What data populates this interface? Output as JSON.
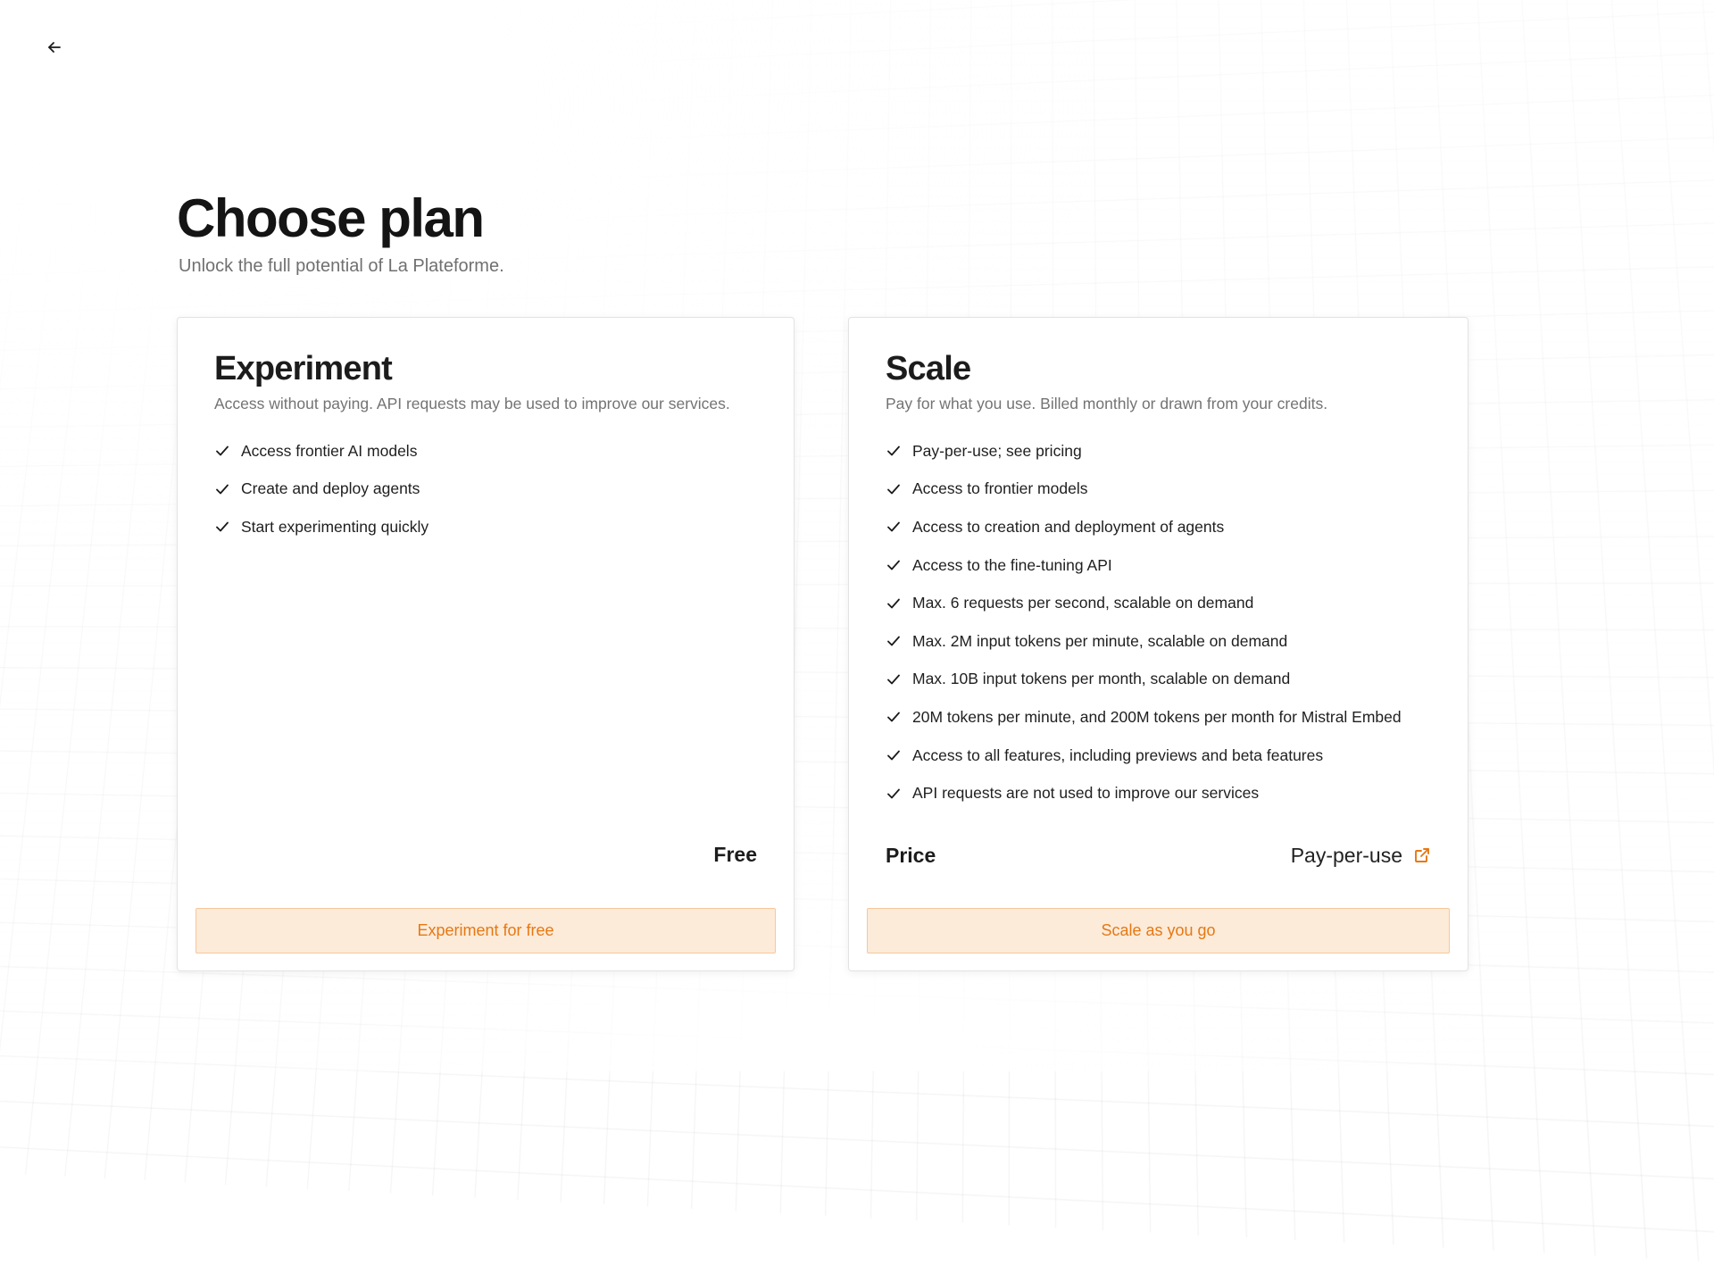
{
  "header": {
    "title": "Choose plan",
    "subtitle": "Unlock the full potential of La Plateforme."
  },
  "icons": {
    "back": "arrow-left-icon",
    "check": "check-icon",
    "external": "external-link-icon"
  },
  "colors": {
    "accent": "#e67813",
    "cta_background": "#fdebd9",
    "cta_border": "#f6c79a"
  },
  "plans": {
    "experiment": {
      "title": "Experiment",
      "description": "Access without paying. API requests may be used to improve our services.",
      "features": [
        "Access frontier AI models",
        "Create and deploy agents",
        "Start experimenting quickly"
      ],
      "price_value": "Free",
      "cta_label": "Experiment for free"
    },
    "scale": {
      "title": "Scale",
      "description": "Pay for what you use. Billed monthly or drawn from your credits.",
      "features": [
        "Pay-per-use; see pricing",
        "Access to frontier models",
        "Access to creation and deployment of agents",
        "Access to the fine-tuning API",
        "Max. 6 requests per second, scalable on demand",
        "Max. 2M input tokens per minute, scalable on demand",
        "Max. 10B input tokens per month, scalable on demand",
        "20M tokens per minute, and 200M tokens per month for Mistral Embed",
        "Access to all features, including previews and beta features",
        "API requests are not used to improve our services"
      ],
      "price_label": "Price",
      "price_value": "Pay-per-use",
      "cta_label": "Scale as you go"
    }
  }
}
